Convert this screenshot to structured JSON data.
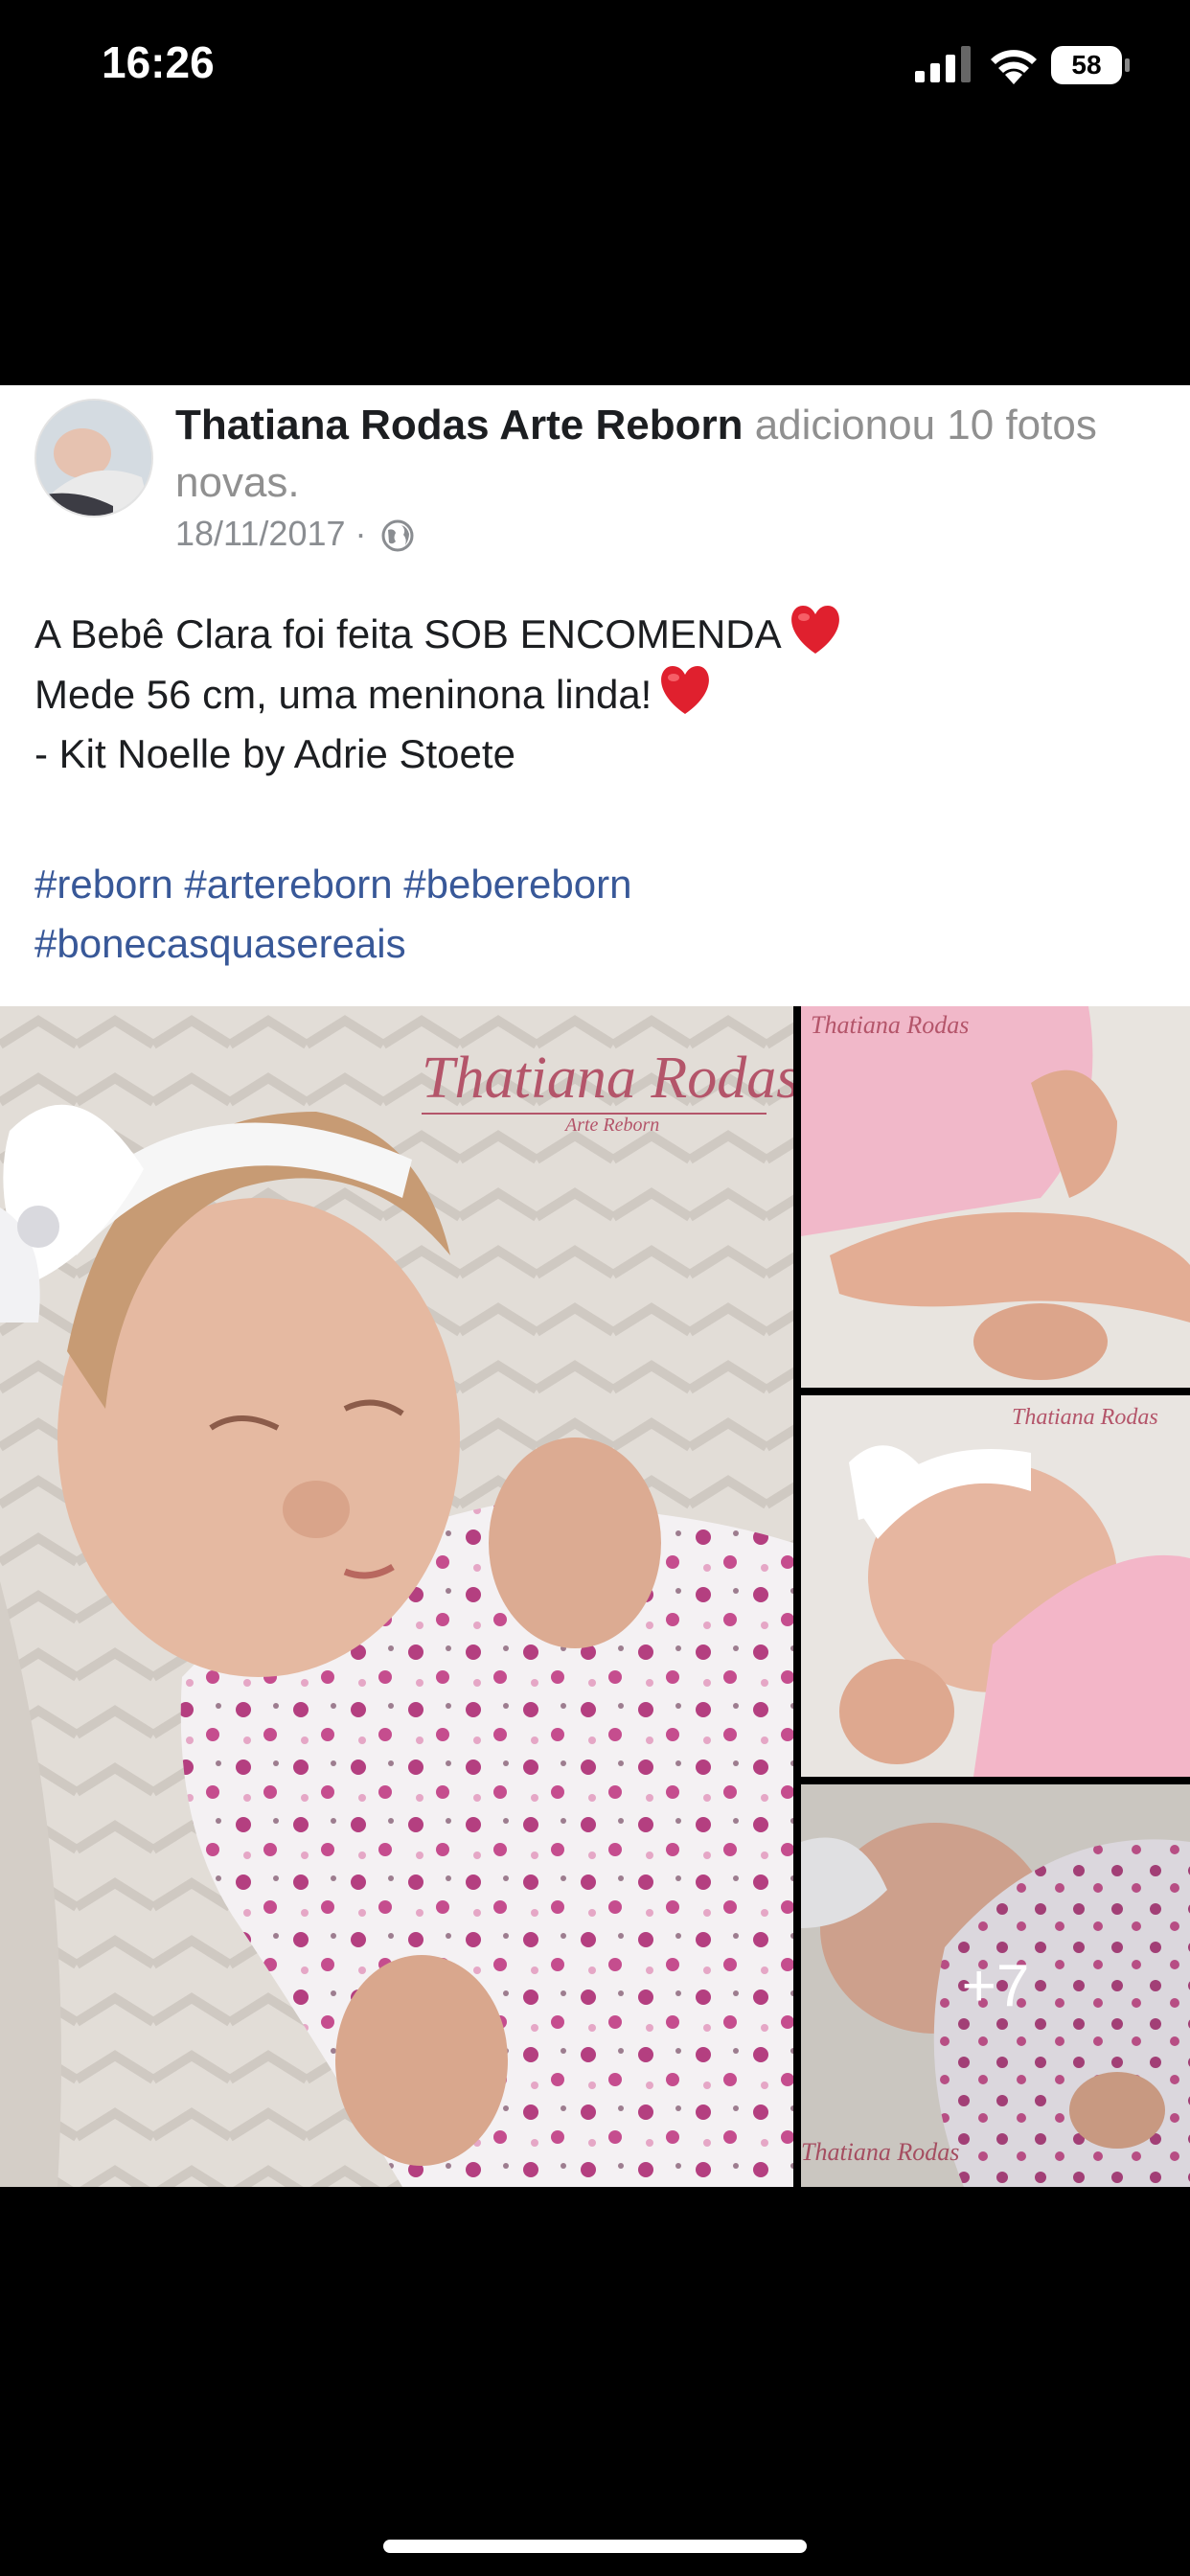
{
  "status_bar": {
    "time": "16:26",
    "battery": "58",
    "icons": [
      "cellular-signal-icon",
      "wifi-icon",
      "battery-icon"
    ]
  },
  "post": {
    "author": "Thatiana Rodas Arte Reborn",
    "action": "adicionou 10 fotos novas.",
    "date": "18/11/2017",
    "date_separator": "·",
    "privacy_icon": "globe-icon",
    "text_lines": [
      "A Bebê Clara foi feita SOB ENCOMENDA",
      "Mede 56 cm, uma meninona linda!",
      "- Kit Noelle by Adrie Stoete"
    ],
    "hashtags": [
      "#reborn #artereborn #bebereborn",
      "#bonecasquasereais"
    ]
  },
  "photos": {
    "watermark_main_name": "Thatiana Rodas",
    "watermark_main_sub": "Arte Reborn",
    "watermark_thumb": "Thatiana Rodas",
    "more_count": "+7"
  },
  "colors": {
    "link": "#385898",
    "heart": "#e0202e",
    "text": "#1c1e21",
    "muted": "#8a8d91",
    "watermark": "#b4556a"
  }
}
